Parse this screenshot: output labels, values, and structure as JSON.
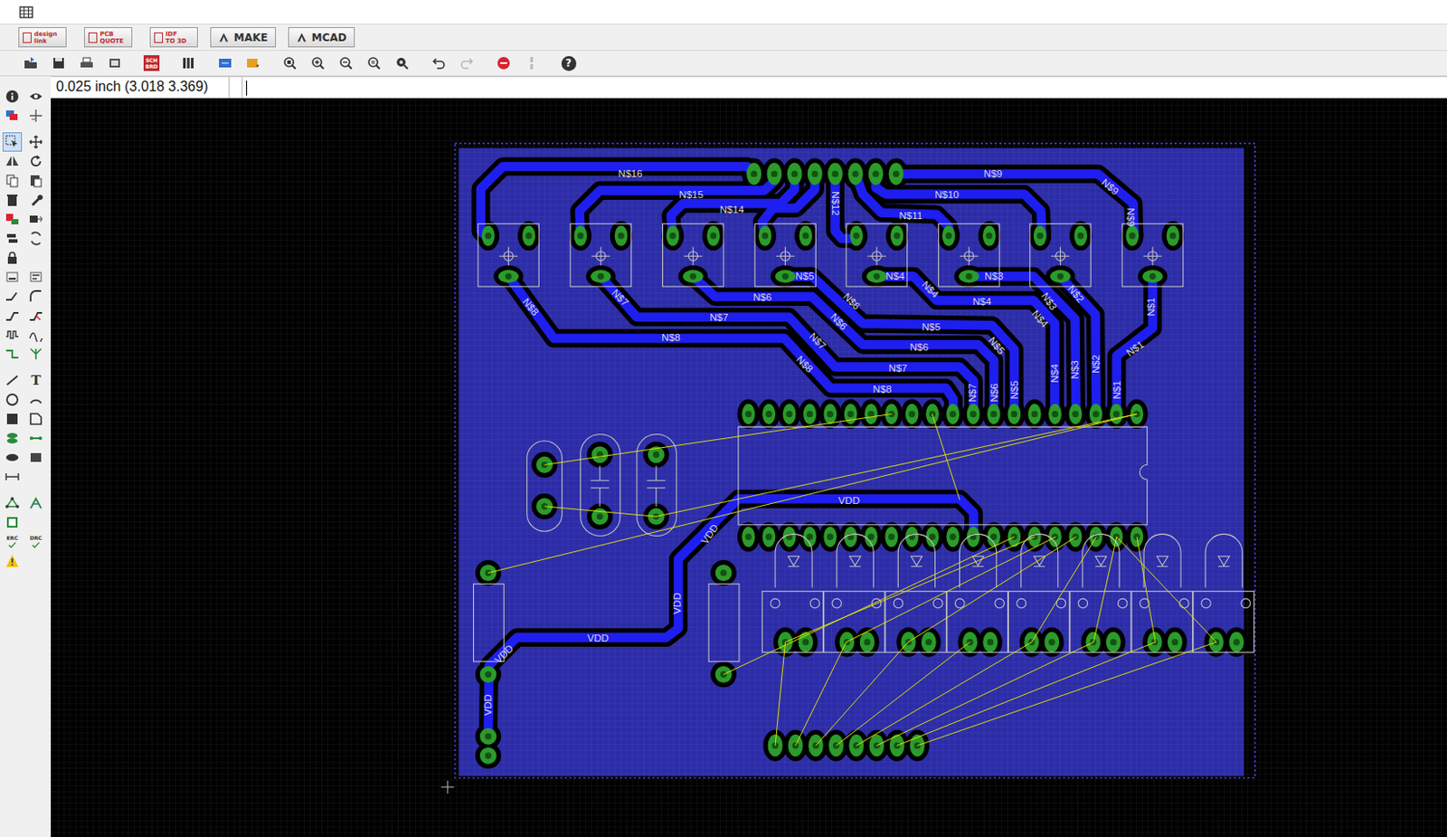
{
  "app_buttons": [
    {
      "kind": "logo",
      "lines": [
        "design",
        "link"
      ]
    },
    {
      "kind": "logo",
      "lines": [
        "PCB",
        "QUOTE"
      ]
    },
    {
      "kind": "logo",
      "lines": [
        "IDF",
        "TO 3D"
      ]
    },
    {
      "kind": "text",
      "lines": [
        "MAKE"
      ]
    },
    {
      "kind": "text",
      "lines": [
        "MCAD"
      ]
    }
  ],
  "toolbar": {
    "sch_brd": [
      "SCH",
      "BRD"
    ],
    "help_glyph": "?",
    "redo_disabled": true,
    "pause_disabled": true
  },
  "command_line": {
    "coordinates": "0.025 inch (3.018 3.369)",
    "value": ""
  },
  "left_toolbar": {
    "text_tool": "T",
    "erc": "ERC",
    "drc": "DRC",
    "selected_tool": "select"
  },
  "board": {
    "net_labels": [
      "N$16",
      "N$15",
      "N$14",
      "N$12",
      "N$11",
      "N$10",
      "N$9",
      "N$9",
      "N$9",
      "N$8",
      "N$7",
      "N$5",
      "N$4",
      "N$3",
      "N$6",
      "N$6",
      "N$4",
      "N$4",
      "N$3",
      "N$2",
      "N$1",
      "N$7",
      "N$6",
      "N$5",
      "N$4",
      "N$1",
      "N$8",
      "N$7",
      "N$5",
      "N$6",
      "N$8",
      "N$7",
      "N$4",
      "N$3",
      "N$2",
      "N$8",
      "N$7",
      "N$6",
      "N$5",
      "N$1",
      "VDD",
      "VDD",
      "VDD",
      "VDD",
      "VDD",
      "VDD"
    ]
  }
}
